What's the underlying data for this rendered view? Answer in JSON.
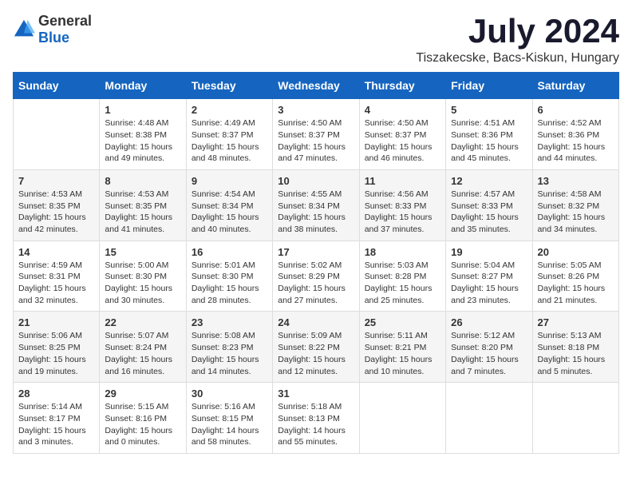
{
  "logo": {
    "general": "General",
    "blue": "Blue"
  },
  "title": "July 2024",
  "location": "Tiszakecske, Bacs-Kiskun, Hungary",
  "days_of_week": [
    "Sunday",
    "Monday",
    "Tuesday",
    "Wednesday",
    "Thursday",
    "Friday",
    "Saturday"
  ],
  "weeks": [
    [
      {
        "day": "",
        "content": ""
      },
      {
        "day": "1",
        "content": "Sunrise: 4:48 AM\nSunset: 8:38 PM\nDaylight: 15 hours\nand 49 minutes."
      },
      {
        "day": "2",
        "content": "Sunrise: 4:49 AM\nSunset: 8:37 PM\nDaylight: 15 hours\nand 48 minutes."
      },
      {
        "day": "3",
        "content": "Sunrise: 4:50 AM\nSunset: 8:37 PM\nDaylight: 15 hours\nand 47 minutes."
      },
      {
        "day": "4",
        "content": "Sunrise: 4:50 AM\nSunset: 8:37 PM\nDaylight: 15 hours\nand 46 minutes."
      },
      {
        "day": "5",
        "content": "Sunrise: 4:51 AM\nSunset: 8:36 PM\nDaylight: 15 hours\nand 45 minutes."
      },
      {
        "day": "6",
        "content": "Sunrise: 4:52 AM\nSunset: 8:36 PM\nDaylight: 15 hours\nand 44 minutes."
      }
    ],
    [
      {
        "day": "7",
        "content": "Sunrise: 4:53 AM\nSunset: 8:35 PM\nDaylight: 15 hours\nand 42 minutes."
      },
      {
        "day": "8",
        "content": "Sunrise: 4:53 AM\nSunset: 8:35 PM\nDaylight: 15 hours\nand 41 minutes."
      },
      {
        "day": "9",
        "content": "Sunrise: 4:54 AM\nSunset: 8:34 PM\nDaylight: 15 hours\nand 40 minutes."
      },
      {
        "day": "10",
        "content": "Sunrise: 4:55 AM\nSunset: 8:34 PM\nDaylight: 15 hours\nand 38 minutes."
      },
      {
        "day": "11",
        "content": "Sunrise: 4:56 AM\nSunset: 8:33 PM\nDaylight: 15 hours\nand 37 minutes."
      },
      {
        "day": "12",
        "content": "Sunrise: 4:57 AM\nSunset: 8:33 PM\nDaylight: 15 hours\nand 35 minutes."
      },
      {
        "day": "13",
        "content": "Sunrise: 4:58 AM\nSunset: 8:32 PM\nDaylight: 15 hours\nand 34 minutes."
      }
    ],
    [
      {
        "day": "14",
        "content": "Sunrise: 4:59 AM\nSunset: 8:31 PM\nDaylight: 15 hours\nand 32 minutes."
      },
      {
        "day": "15",
        "content": "Sunrise: 5:00 AM\nSunset: 8:30 PM\nDaylight: 15 hours\nand 30 minutes."
      },
      {
        "day": "16",
        "content": "Sunrise: 5:01 AM\nSunset: 8:30 PM\nDaylight: 15 hours\nand 28 minutes."
      },
      {
        "day": "17",
        "content": "Sunrise: 5:02 AM\nSunset: 8:29 PM\nDaylight: 15 hours\nand 27 minutes."
      },
      {
        "day": "18",
        "content": "Sunrise: 5:03 AM\nSunset: 8:28 PM\nDaylight: 15 hours\nand 25 minutes."
      },
      {
        "day": "19",
        "content": "Sunrise: 5:04 AM\nSunset: 8:27 PM\nDaylight: 15 hours\nand 23 minutes."
      },
      {
        "day": "20",
        "content": "Sunrise: 5:05 AM\nSunset: 8:26 PM\nDaylight: 15 hours\nand 21 minutes."
      }
    ],
    [
      {
        "day": "21",
        "content": "Sunrise: 5:06 AM\nSunset: 8:25 PM\nDaylight: 15 hours\nand 19 minutes."
      },
      {
        "day": "22",
        "content": "Sunrise: 5:07 AM\nSunset: 8:24 PM\nDaylight: 15 hours\nand 16 minutes."
      },
      {
        "day": "23",
        "content": "Sunrise: 5:08 AM\nSunset: 8:23 PM\nDaylight: 15 hours\nand 14 minutes."
      },
      {
        "day": "24",
        "content": "Sunrise: 5:09 AM\nSunset: 8:22 PM\nDaylight: 15 hours\nand 12 minutes."
      },
      {
        "day": "25",
        "content": "Sunrise: 5:11 AM\nSunset: 8:21 PM\nDaylight: 15 hours\nand 10 minutes."
      },
      {
        "day": "26",
        "content": "Sunrise: 5:12 AM\nSunset: 8:20 PM\nDaylight: 15 hours\nand 7 minutes."
      },
      {
        "day": "27",
        "content": "Sunrise: 5:13 AM\nSunset: 8:18 PM\nDaylight: 15 hours\nand 5 minutes."
      }
    ],
    [
      {
        "day": "28",
        "content": "Sunrise: 5:14 AM\nSunset: 8:17 PM\nDaylight: 15 hours\nand 3 minutes."
      },
      {
        "day": "29",
        "content": "Sunrise: 5:15 AM\nSunset: 8:16 PM\nDaylight: 15 hours\nand 0 minutes."
      },
      {
        "day": "30",
        "content": "Sunrise: 5:16 AM\nSunset: 8:15 PM\nDaylight: 14 hours\nand 58 minutes."
      },
      {
        "day": "31",
        "content": "Sunrise: 5:18 AM\nSunset: 8:13 PM\nDaylight: 14 hours\nand 55 minutes."
      },
      {
        "day": "",
        "content": ""
      },
      {
        "day": "",
        "content": ""
      },
      {
        "day": "",
        "content": ""
      }
    ]
  ]
}
